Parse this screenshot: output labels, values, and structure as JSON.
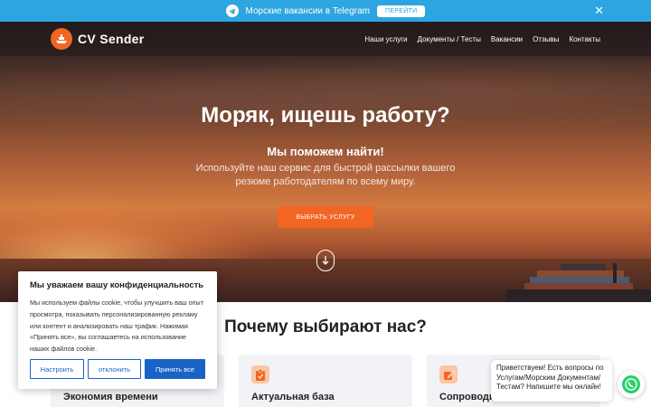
{
  "telegram_banner": {
    "text": "Морские вакансии в Telegram",
    "button_label": "ПЕРЕЙТИ",
    "close_symbol": "✕",
    "color": "#2ca5e0"
  },
  "header": {
    "logo_text": "CV Sender",
    "brand_color": "#f26522",
    "nav": [
      {
        "label": "Наши услуги"
      },
      {
        "label": "Документы / Тесты"
      },
      {
        "label": "Вакансии"
      },
      {
        "label": "Отзывы"
      },
      {
        "label": "Контакты"
      }
    ]
  },
  "hero": {
    "title": "Моряк, ищешь работу?",
    "subtitle": "Мы поможем найти!",
    "description": "Используйте наш сервис для быстрой рассылки вашего резюме работодателям по всему миру.",
    "cta_label": "ВЫБРАТЬ УСЛУГУ"
  },
  "why": {
    "title": "Почему выбирают нас?",
    "cards": [
      {
        "title": "Экономия времени",
        "icon": "clock-icon"
      },
      {
        "title": "Актуальная база",
        "icon": "clipboard-check-icon"
      },
      {
        "title": "Сопроводительное письмо",
        "icon": "pencil-icon"
      }
    ]
  },
  "cookie": {
    "title": "Мы уважаем вашу конфиденциальность",
    "text": "Мы используем файлы cookie, чтобы улучшить ваш опыт просмотра, показывать персонализированную рекламу или контент и анализировать наш трафик. Нажимая «Принять все», вы соглашаетесь на использование наших файлов cookie.",
    "buttons": {
      "customize": "Настроить",
      "reject": "отклонить",
      "accept": "Принять все"
    },
    "accent": "#1a63c6"
  },
  "chat": {
    "message": "Приветствуем! Есть вопросы по Услугам/Морским Документам/Тестам? Напишите мы онлайн!",
    "icon": "whatsapp-icon",
    "icon_color": "#25d366"
  }
}
